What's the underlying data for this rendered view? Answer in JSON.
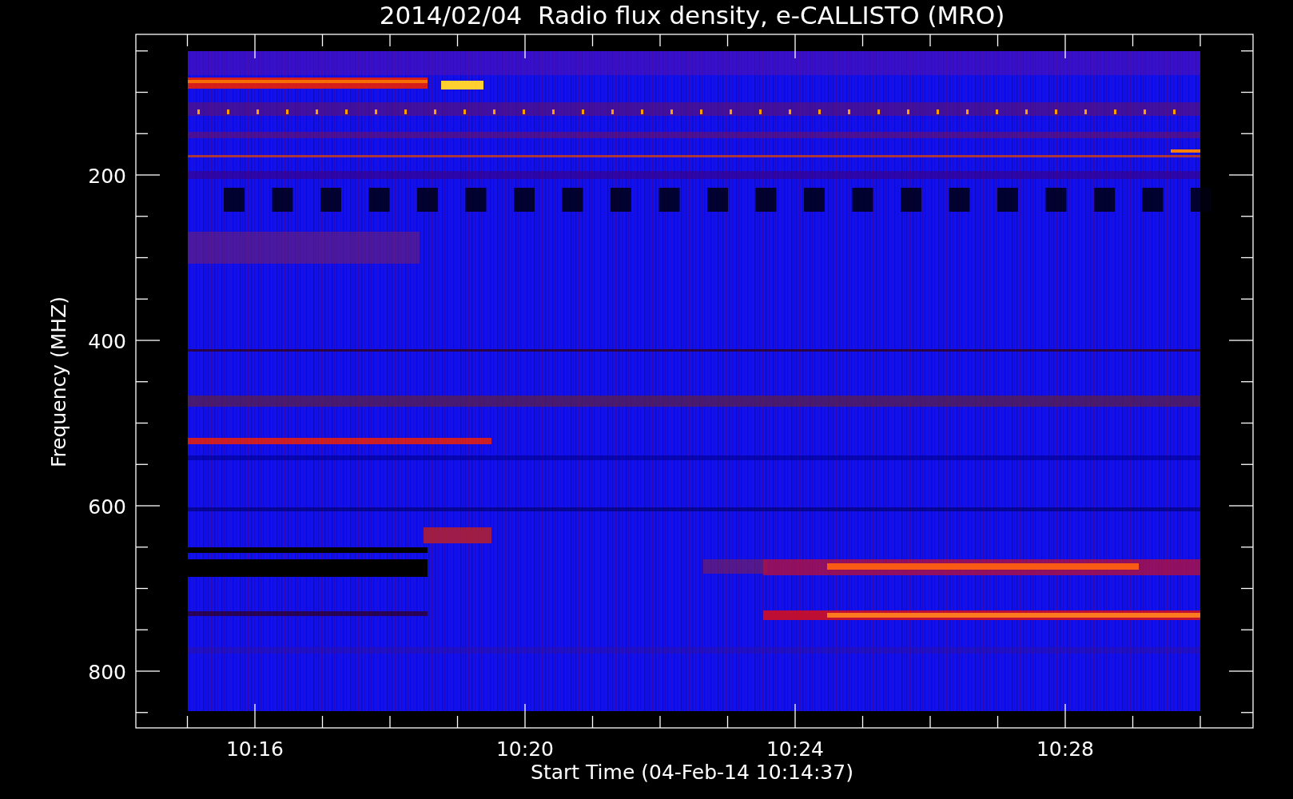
{
  "plot": {
    "title": "2014/02/04  Radio flux density, e-CALLISTO (MRO)",
    "xlabel": "Start Time (04-Feb-14 10:14:37)",
    "ylabel": "Frequency (MHZ)",
    "xtick_labels": [
      "10:16",
      "10:20",
      "10:24",
      "10:28"
    ],
    "ytick_labels": [
      "200",
      "400",
      "600",
      "800"
    ]
  }
}
